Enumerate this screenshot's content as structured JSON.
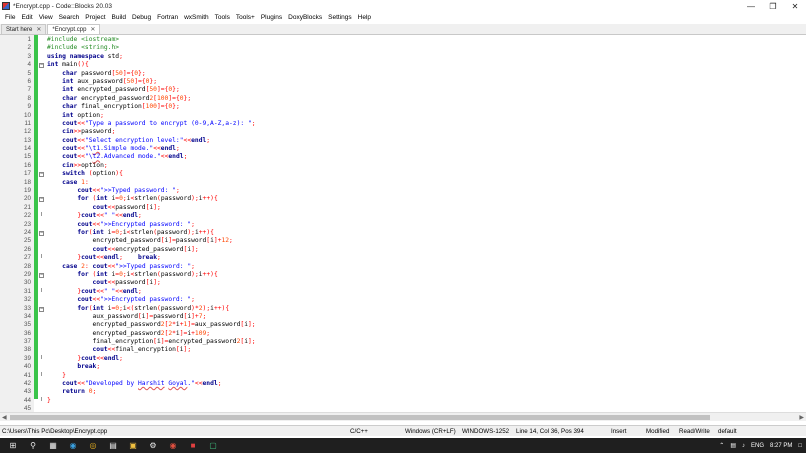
{
  "window": {
    "title": "*Encrypt.cpp - Code::Blocks 20.03"
  },
  "menu": [
    "File",
    "Edit",
    "View",
    "Search",
    "Project",
    "Build",
    "Debug",
    "Fortran",
    "wxSmith",
    "Tools",
    "Tools+",
    "Plugins",
    "DoxyBlocks",
    "Settings",
    "Help"
  ],
  "tabs": [
    {
      "label": "Start here",
      "active": false
    },
    {
      "label": "*Encrypt.cpp",
      "active": true
    }
  ],
  "code": [
    "#include <iostream>",
    "#include <string.h>",
    "using namespace std;",
    "int main(){",
    "    char password[50]={0};",
    "    int aux_password[50]={0};",
    "    int encrypted_password[50]={0};",
    "    char encrypted_password2[100]={0};",
    "    char final_encryption[100]={0};",
    "    int option;",
    "    cout<<\"Type a password to encrypt (0-9,A-Z,a-z): \";",
    "    cin>>password;",
    "    cout<<\"Select encryption level:\"<<endl;",
    "    cout<<\"\\t1.Simple mode.\"<<endl;",
    "    cout<<\"\\t2.Advanced mode.\"<<endl;",
    "    cin>>option;",
    "    switch (option){",
    "    case 1:",
    "        cout<<\">>Typed password: \";",
    "        for (int i=0;i<strlen(password);i++){",
    "            cout<<password[i];",
    "        }cout<<\" \"<<endl;",
    "        cout<<\">>Encrypted password: \";",
    "        for(int i=0;i<strlen(password);i++){",
    "            encrypted_password[i]=password[i]+12;",
    "            cout<<encrypted_password[i];",
    "        }cout<<endl;    break;",
    "    case 2: cout<<\">>Typed password: \";",
    "        for (int i=0;i<strlen(password);i++){",
    "            cout<<password[i];",
    "        }cout<<\" \"<<endl;",
    "        cout<<\">>Encrypted password: \";",
    "        for(int i=0;i<(strlen(password)*2);i++){",
    "            aux_password[i]=password[i]+7;",
    "            encrypted_password2[2*i+1]=aux_password[i];",
    "            encrypted_password2[2*i]=i+109;",
    "            final_encryption[i]=encrypted_password2[i];",
    "            cout<<final_encryption[i];",
    "        }cout<<endl;",
    "        break;",
    "    }",
    "    cout<<\"Developed by Harshit Goyal.\"<<endl;",
    "    return 0;",
    "}",
    ""
  ],
  "status": {
    "path": "C:\\Users\\This Pc\\Desktop\\Encrypt.cpp",
    "language": "C/C++",
    "eol": "Windows (CR+LF)",
    "encoding": "WINDOWS-1252",
    "position": "Line 14, Col 36, Pos 394",
    "mode": "Insert",
    "modified": "Modified",
    "access": "Read/Write",
    "profile": "default"
  },
  "taskbar": {
    "time": "8:27 PM",
    "language": "ENG"
  }
}
